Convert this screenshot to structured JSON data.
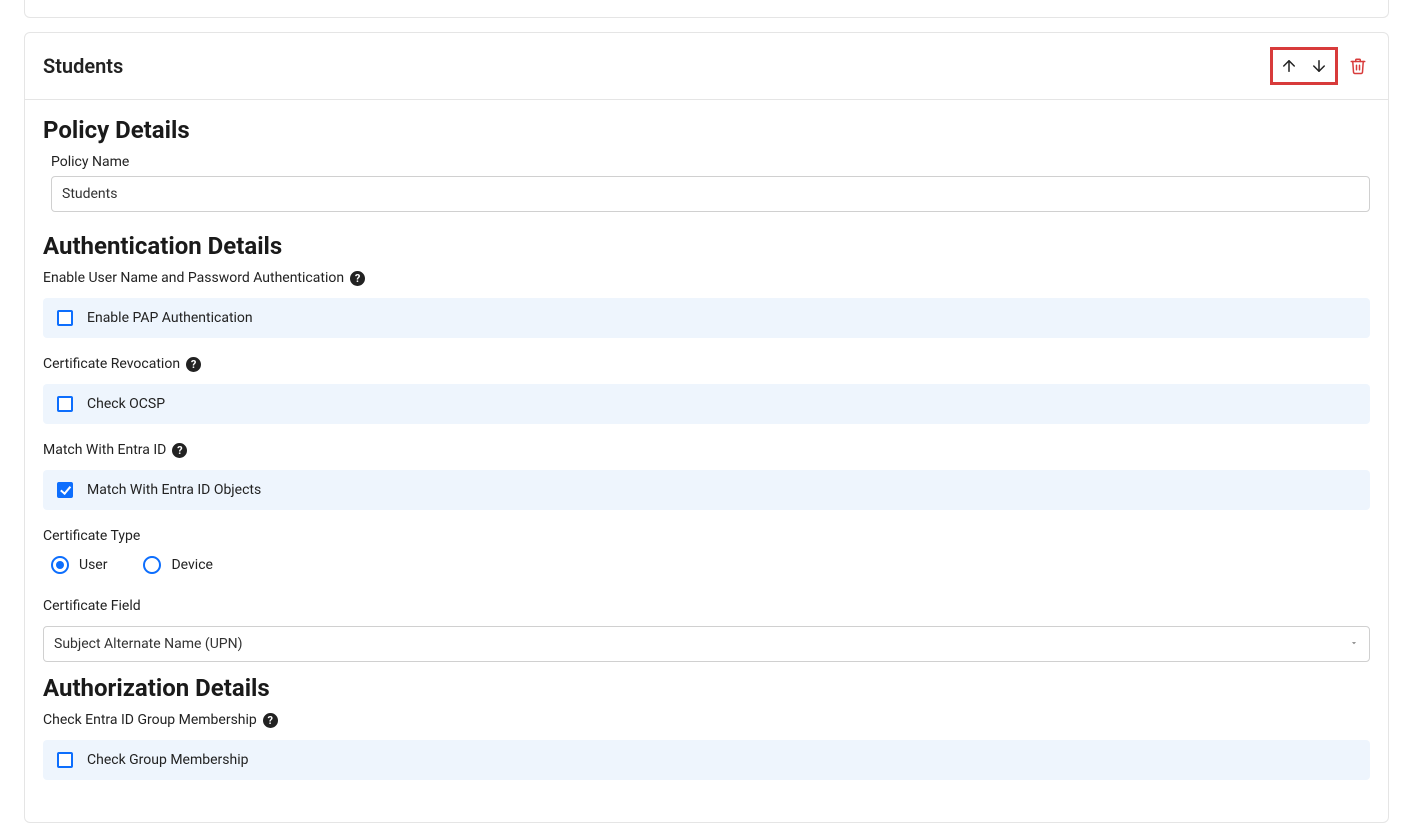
{
  "header": {
    "title": "Students"
  },
  "sections": {
    "policy_details": {
      "title": "Policy Details",
      "policy_name_label": "Policy Name",
      "policy_name_value": "Students"
    },
    "auth_details": {
      "title": "Authentication Details",
      "enable_user_pass_label": "Enable User Name and Password Authentication",
      "enable_pap_label": "Enable PAP Authentication",
      "cert_revocation_label": "Certificate Revocation",
      "check_ocsp_label": "Check OCSP",
      "match_entra_label": "Match With Entra ID",
      "match_entra_objects_label": "Match With Entra ID Objects",
      "cert_type_label": "Certificate Type",
      "cert_type_user": "User",
      "cert_type_device": "Device",
      "cert_field_label": "Certificate Field",
      "cert_field_value": "Subject Alternate Name (UPN)"
    },
    "authz_details": {
      "title": "Authorization Details",
      "check_group_label": "Check Entra ID Group Membership",
      "check_group_membership_label": "Check Group Membership"
    }
  }
}
